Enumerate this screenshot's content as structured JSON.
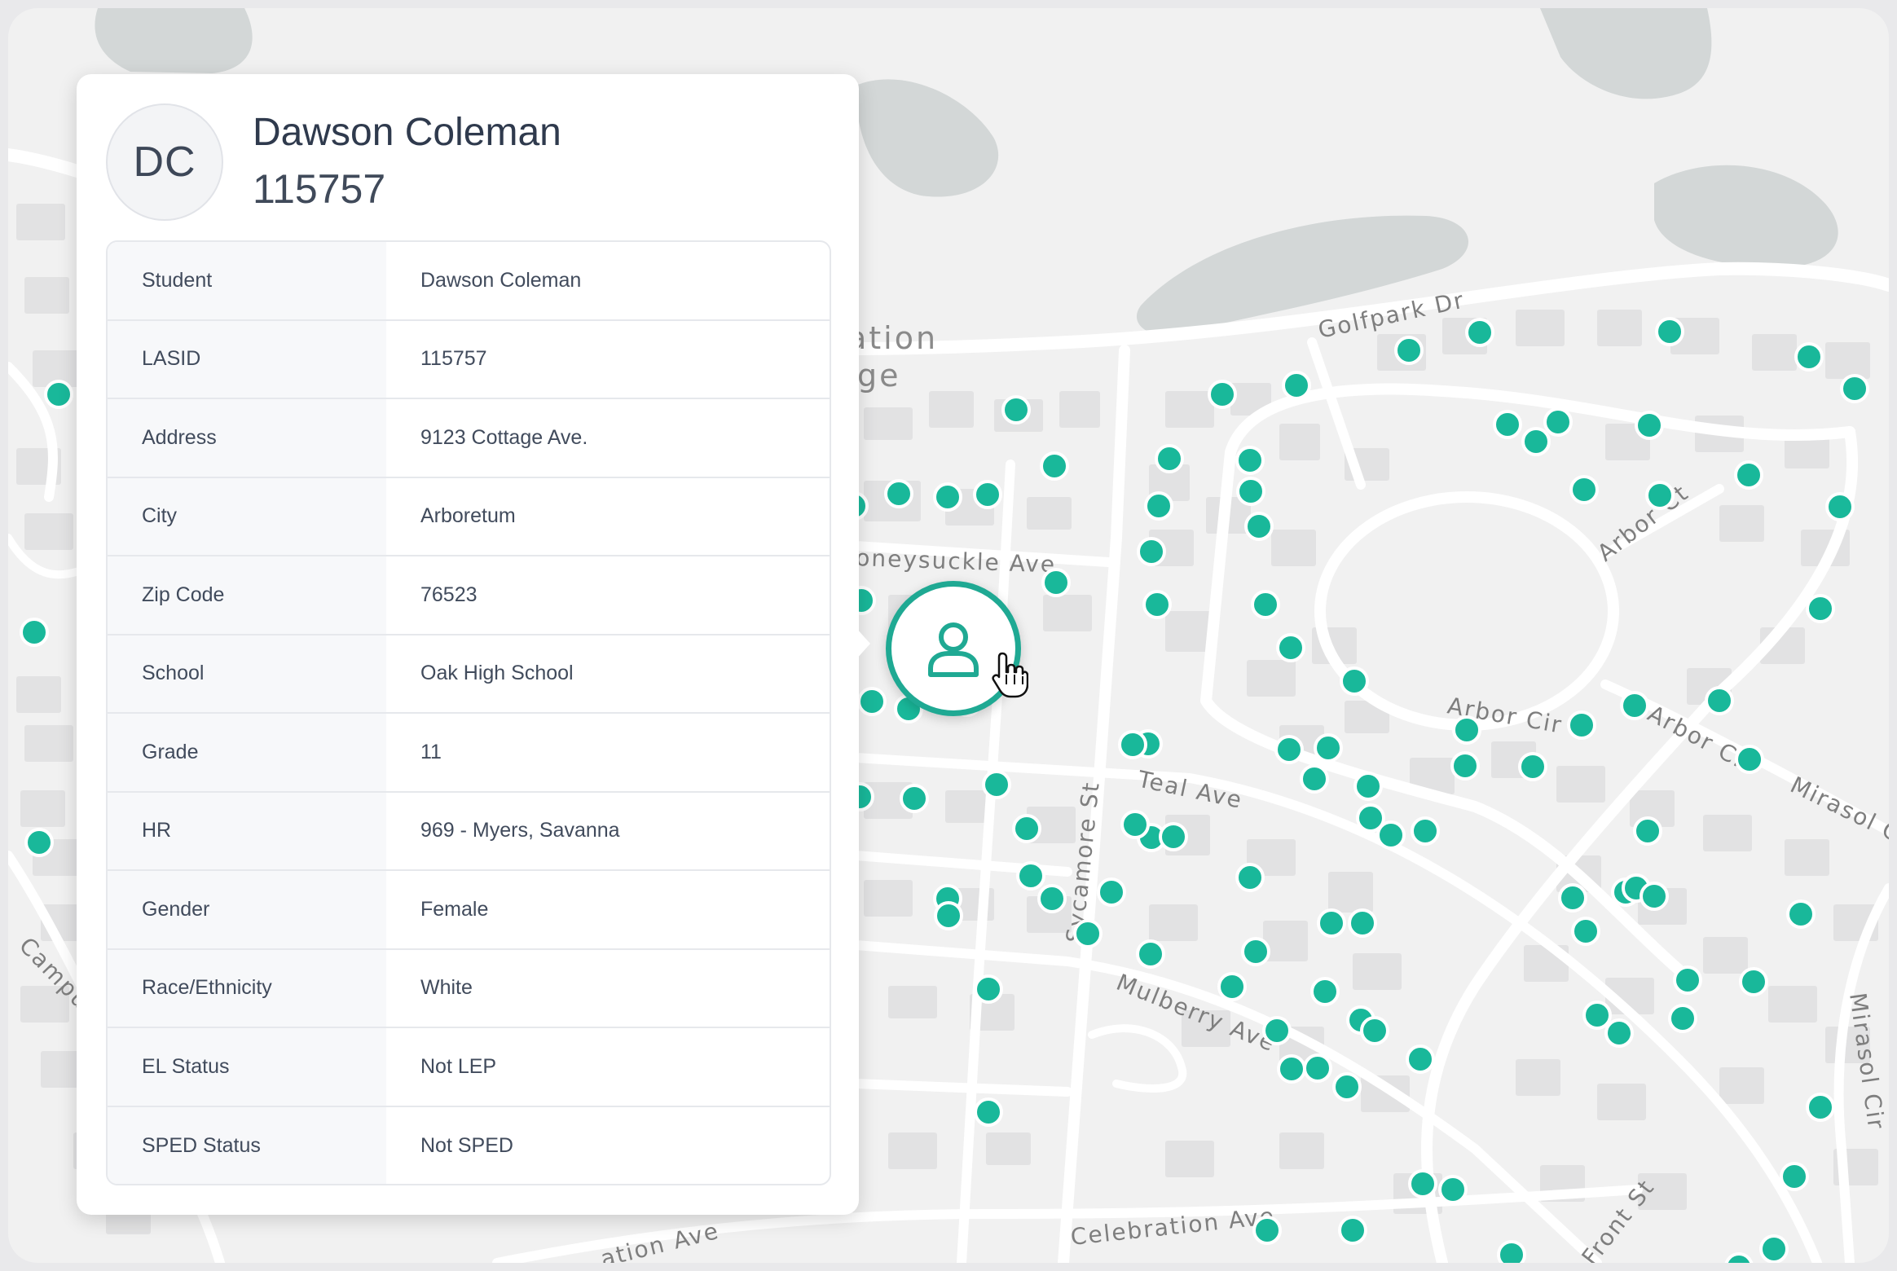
{
  "colors": {
    "pin": "#19b89a",
    "selected_ring": "#1fa993",
    "water": "#d3d7d7",
    "land": "#f1f1f1",
    "road": "#ffffff"
  },
  "map": {
    "area_label_line1": "ation",
    "area_label_line2": "ge",
    "streets": {
      "golfpark": "Golfpark Dr",
      "honeysuckle": "oneysuckle Ave",
      "arbor_ct": "Arbor Ct",
      "arbor_cir_1": "Arbor Cir",
      "arbor_cir_2": "Arbor Cir",
      "mirasol_cir_1": "Mirasol Cir",
      "mirasol_cir_2": "Mirasol Cir",
      "teal": "Teal Ave",
      "sycamore": "Sycamore St",
      "mulberry": "Mulberry Ave",
      "celebration": "Celebration Ave",
      "ation_ave": "ation Ave",
      "front": "Front St",
      "campus": "Campus"
    }
  },
  "selected_marker": {
    "icon": "person-icon"
  },
  "student_card": {
    "initials": "DC",
    "name": "Dawson Coleman",
    "id": "115757",
    "rows": [
      {
        "label": "Student",
        "value": "Dawson Coleman"
      },
      {
        "label": "LASID",
        "value": "115757"
      },
      {
        "label": "Address",
        "value": "9123 Cottage Ave."
      },
      {
        "label": "City",
        "value": "Arboretum"
      },
      {
        "label": "Zip Code",
        "value": "76523"
      },
      {
        "label": "School",
        "value": "Oak High School"
      },
      {
        "label": "Grade",
        "value": "11"
      },
      {
        "label": "HR",
        "value": "969 - Myers, Savanna"
      },
      {
        "label": "Gender",
        "value": "Female"
      },
      {
        "label": "Race/Ethnicity",
        "value": "White"
      },
      {
        "label": "EL Status",
        "value": "Not LEP"
      },
      {
        "label": "SPED Status",
        "value": "Not SPED"
      }
    ]
  }
}
